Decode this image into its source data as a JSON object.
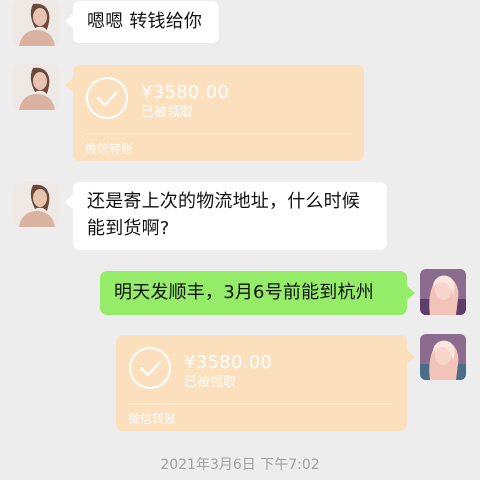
{
  "messages": {
    "m1": {
      "text": "嗯嗯 转钱给你"
    },
    "m2": {
      "amount": "¥3580.00",
      "status": "已被领取",
      "footer": "微信转账"
    },
    "m3": {
      "line1": "还是寄上次的物流地址，什么时候",
      "line2": "能到货啊?"
    },
    "m4": {
      "text": "明天发顺丰，3月6号前能到杭州"
    },
    "m5": {
      "amount": "¥3580.00",
      "status": "已被领取",
      "footer": "微信转账"
    }
  },
  "timestamp": "2021年3月6日 下午7:02",
  "colors": {
    "background": "#ededed",
    "received_bubble": "#ffffff",
    "sent_bubble": "#95ec69",
    "transfer_card": "#fce0bd",
    "timestamp_text": "#a0a0a0"
  },
  "icons": {
    "transfer_status": "check-circle-icon"
  }
}
